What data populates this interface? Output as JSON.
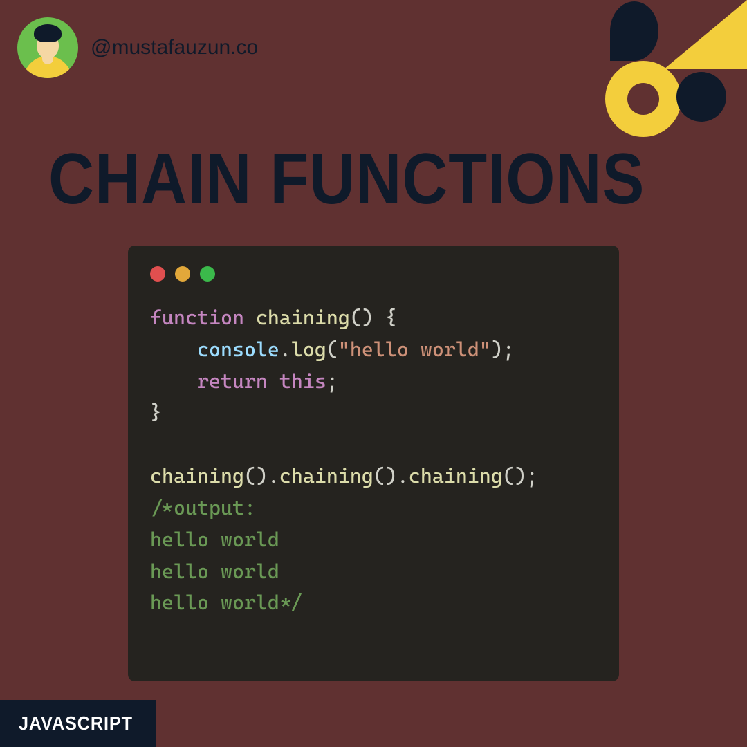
{
  "header": {
    "handle": "@mustafauzun.co"
  },
  "title": "CHAIN FUNCTIONS",
  "code": {
    "kw_function": "function",
    "fn_name": "chaining",
    "console": "console",
    "log": "log",
    "string": "\"hello world\"",
    "kw_return": "return",
    "kw_this": "this",
    "chain_call": "chaining",
    "comment_l1": "/*output:",
    "comment_l2": "hello world",
    "comment_l3": "hello world",
    "comment_l4": "hello world*/"
  },
  "footer": {
    "label": "JAVASCRIPT"
  },
  "colors": {
    "bg": "#603131",
    "dark": "#0f1a2a",
    "yellow": "#F3CE3C",
    "codebg": "#25231f"
  }
}
